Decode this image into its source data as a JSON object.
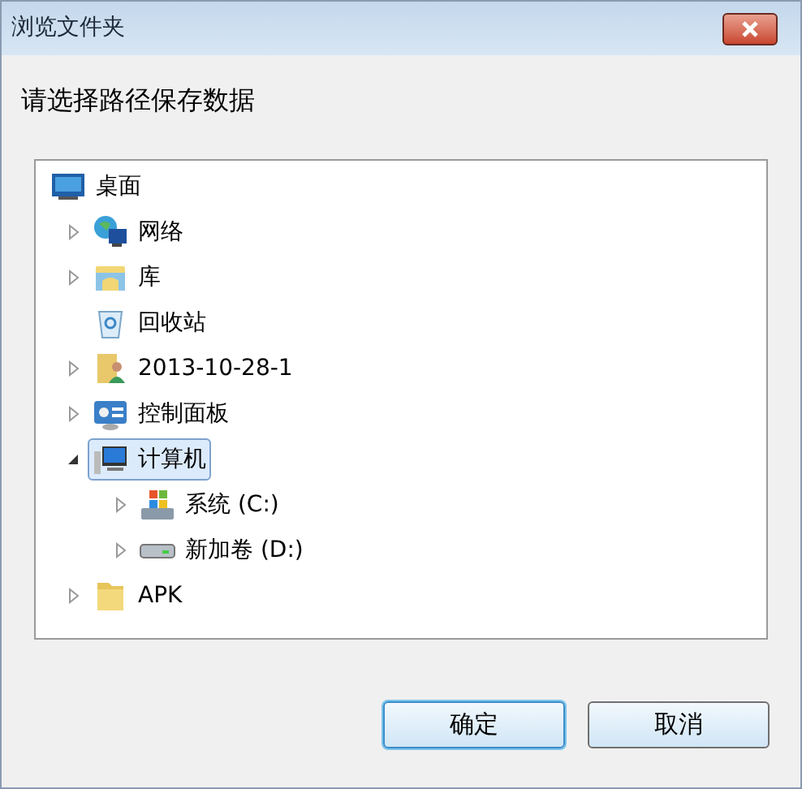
{
  "window": {
    "title": "浏览文件夹"
  },
  "instruction": "请选择路径保存数据",
  "tree": [
    {
      "label": "桌面",
      "kind": "desktop",
      "expandable": false,
      "selected": false,
      "children": [
        {
          "label": "网络",
          "kind": "network",
          "expandable": true,
          "expanded": false,
          "selected": false
        },
        {
          "label": "库",
          "kind": "library",
          "expandable": true,
          "expanded": false,
          "selected": false
        },
        {
          "label": "回收站",
          "kind": "recycle",
          "expandable": false,
          "selected": false
        },
        {
          "label": "2013-10-28-1",
          "kind": "user",
          "expandable": true,
          "expanded": false,
          "selected": false
        },
        {
          "label": "控制面板",
          "kind": "control",
          "expandable": true,
          "expanded": false,
          "selected": false
        },
        {
          "label": "计算机",
          "kind": "computer",
          "expandable": true,
          "expanded": true,
          "selected": true,
          "children": [
            {
              "label": "系统 (C:)",
              "kind": "sysdrive",
              "expandable": true,
              "expanded": false,
              "selected": false
            },
            {
              "label": "新加卷 (D:)",
              "kind": "drive",
              "expandable": true,
              "expanded": false,
              "selected": false
            }
          ]
        },
        {
          "label": "APK",
          "kind": "folder",
          "expandable": true,
          "expanded": false,
          "selected": false
        }
      ]
    }
  ],
  "buttons": [
    {
      "label": "确定",
      "default": true
    },
    {
      "label": "取消",
      "default": false
    }
  ]
}
